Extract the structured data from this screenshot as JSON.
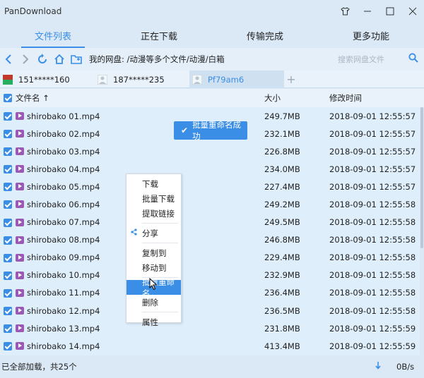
{
  "app": {
    "title": "PanDownload"
  },
  "window_buttons": [
    "skin-icon",
    "minimize-icon",
    "maximize-icon",
    "close-icon"
  ],
  "tabs": [
    {
      "label": "文件列表",
      "active": true
    },
    {
      "label": "正在下载",
      "active": false
    },
    {
      "label": "传输完成",
      "active": false
    },
    {
      "label": "更多功能",
      "active": false
    }
  ],
  "toolbar": {
    "path": "我的网盘: /动漫等多个文件/动漫/白箱",
    "search_placeholder": "搜索网盘文件"
  },
  "accounts": [
    {
      "label": "151*****160",
      "active": false
    },
    {
      "label": "187*****235",
      "active": false
    },
    {
      "label": "Pf79am6",
      "active": true
    }
  ],
  "table": {
    "headers": {
      "name": "文件名 ↑",
      "size": "大小",
      "date": "修改时间"
    },
    "rows": [
      {
        "name": "shirobako 01.mp4",
        "size": "249.7MB",
        "date": "2018-09-01 12:55:57"
      },
      {
        "name": "shirobako 02.mp4",
        "size": "232.1MB",
        "date": "2018-09-01 12:55:57"
      },
      {
        "name": "shirobako 03.mp4",
        "size": "226.8MB",
        "date": "2018-09-01 12:55:57"
      },
      {
        "name": "shirobako 04.mp4",
        "size": "234.0MB",
        "date": "2018-09-01 12:55:57"
      },
      {
        "name": "shirobako 05.mp4",
        "size": "227.4MB",
        "date": "2018-09-01 12:55:57"
      },
      {
        "name": "shirobako 06.mp4",
        "size": "249.2MB",
        "date": "2018-09-01 12:55:58"
      },
      {
        "name": "shirobako 07.mp4",
        "size": "249.5MB",
        "date": "2018-09-01 12:55:58"
      },
      {
        "name": "shirobako 08.mp4",
        "size": "246.8MB",
        "date": "2018-09-01 12:55:58"
      },
      {
        "name": "shirobako 09.mp4",
        "size": "229.4MB",
        "date": "2018-09-01 12:55:58"
      },
      {
        "name": "shirobako 10.mp4",
        "size": "232.9MB",
        "date": "2018-09-01 12:55:58"
      },
      {
        "name": "shirobako 11.mp4",
        "size": "236.4MB",
        "date": "2018-09-01 12:55:58"
      },
      {
        "name": "shirobako 12.mp4",
        "size": "236.5MB",
        "date": "2018-09-01 12:55:58"
      },
      {
        "name": "shirobako 13.mp4",
        "size": "231.8MB",
        "date": "2018-09-01 12:55:59"
      },
      {
        "name": "shirobako 14.mp4",
        "size": "413.4MB",
        "date": "2018-09-01 12:55:59"
      }
    ]
  },
  "toast": {
    "text": "批量重命名成功"
  },
  "context_menu": {
    "groups": [
      [
        "下载",
        "批量下载",
        "提取链接"
      ],
      [
        "分享"
      ],
      [
        "复制到",
        "移动到"
      ],
      [
        "批量重命名",
        "删除"
      ],
      [
        "属性"
      ]
    ],
    "highlighted": "批量重命名"
  },
  "status": {
    "text": "已全部加载，共25个",
    "speed": "0B/s"
  },
  "colors": {
    "accent": "#3a8ee6",
    "background": "#dbe9f7"
  }
}
